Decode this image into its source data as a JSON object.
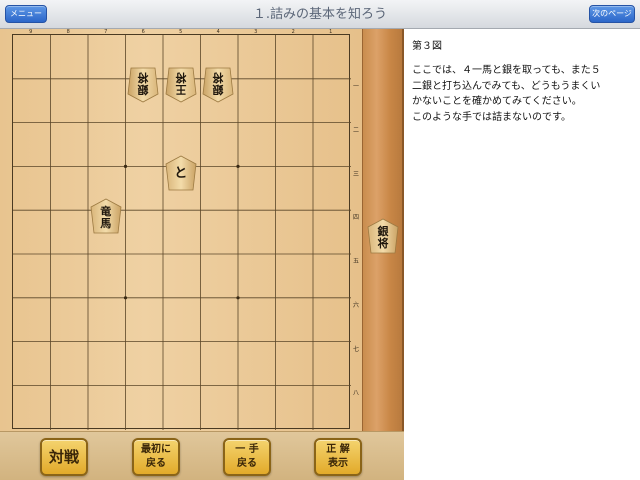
{
  "nav": {
    "menu_label": "メニュー",
    "title": "１.詰みの基本を知ろう",
    "next_label": "次のページ"
  },
  "board": {
    "col_labels": [
      "9",
      "8",
      "7",
      "6",
      "5",
      "4",
      "3",
      "2",
      "1"
    ],
    "row_labels": [
      "一",
      "二",
      "三",
      "四",
      "五",
      "六",
      "七",
      "八",
      "九"
    ],
    "pieces": [
      {
        "name": "gote-silver-6a",
        "file": 6,
        "rank": 1,
        "glyph1": "銀",
        "glyph2": "将",
        "inverted": true
      },
      {
        "name": "gote-king-5a",
        "file": 5,
        "rank": 1,
        "glyph1": "王",
        "glyph2": "将",
        "inverted": true
      },
      {
        "name": "gote-silver-4a",
        "file": 4,
        "rank": 1,
        "glyph1": "銀",
        "glyph2": "将",
        "inverted": true
      },
      {
        "name": "sente-tokin-5c",
        "file": 5,
        "rank": 3,
        "glyph1": "と",
        "glyph2": "",
        "inverted": false
      },
      {
        "name": "sente-promoted-bishop-7d",
        "file": 7,
        "rank": 4,
        "glyph1": "竜",
        "glyph2": "馬",
        "inverted": false
      }
    ]
  },
  "komadai": {
    "pieces": [
      {
        "name": "hand-silver",
        "glyph1": "銀",
        "glyph2": "将"
      }
    ]
  },
  "toolbar": {
    "battle_label": "対戦",
    "back_to_start_line1": "最初に",
    "back_to_start_line2": "戻る",
    "undo_line1": "一 手",
    "undo_line2": "戻る",
    "answer_line1": "正 解",
    "answer_line2": "表示"
  },
  "text_panel": {
    "figure_title": "第３図",
    "lines": [
      "ここでは、４一馬と銀を取っても、また５",
      "二銀と打ち込んでみても、どうもうまくい",
      "かないことを確かめてみてください。",
      "このような手では詰まないのです。"
    ]
  },
  "colors": {
    "nav_button": "#2b66c9",
    "board_wood": "#efd1a3",
    "komadai_wood": "#dca168",
    "tool_button": "#e2aa2a",
    "nav_title_text": "#5b6678"
  }
}
